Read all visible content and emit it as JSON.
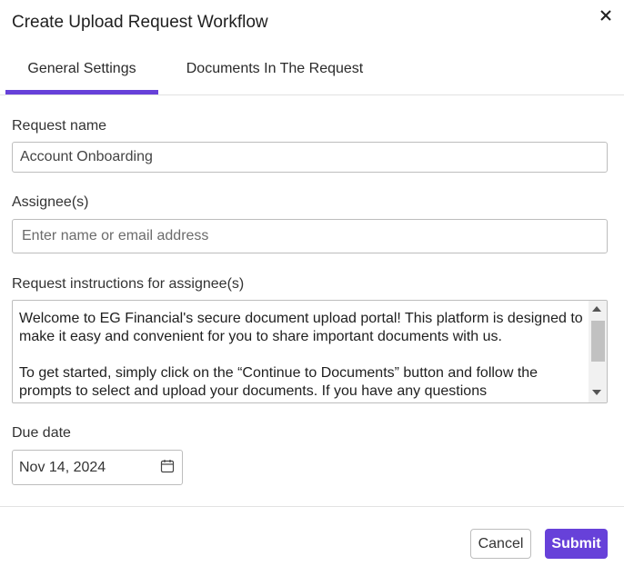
{
  "dialog": {
    "title": "Create Upload Request Workflow"
  },
  "tabs": [
    {
      "label": "General Settings",
      "active": true
    },
    {
      "label": "Documents In The Request",
      "active": false
    }
  ],
  "form": {
    "request_name": {
      "label": "Request name",
      "value": "Account Onboarding"
    },
    "assignees": {
      "label": "Assignee(s)",
      "placeholder": "Enter name or email address"
    },
    "instructions": {
      "label": "Request instructions for assignee(s)",
      "paragraph_1": "Welcome to EG Financial's secure document upload portal! This platform is designed to make it easy and convenient for you to share important documents with us.",
      "paragraph_2": "To get started, simply click on the “Continue to Documents” button and follow the prompts to select and upload your documents. If you have any questions"
    },
    "due_date": {
      "label": "Due date",
      "value": "Nov 14, 2024"
    }
  },
  "footer": {
    "cancel_label": "Cancel",
    "submit_label": "Submit"
  },
  "colors": {
    "accent": "#6741d9",
    "border": "#bdbdbd",
    "divider": "#e2e2e2"
  },
  "icons": {
    "close": "close-icon",
    "calendar": "calendar-icon",
    "scroll_up": "scroll-up-arrow-icon",
    "scroll_down": "scroll-down-arrow-icon"
  }
}
